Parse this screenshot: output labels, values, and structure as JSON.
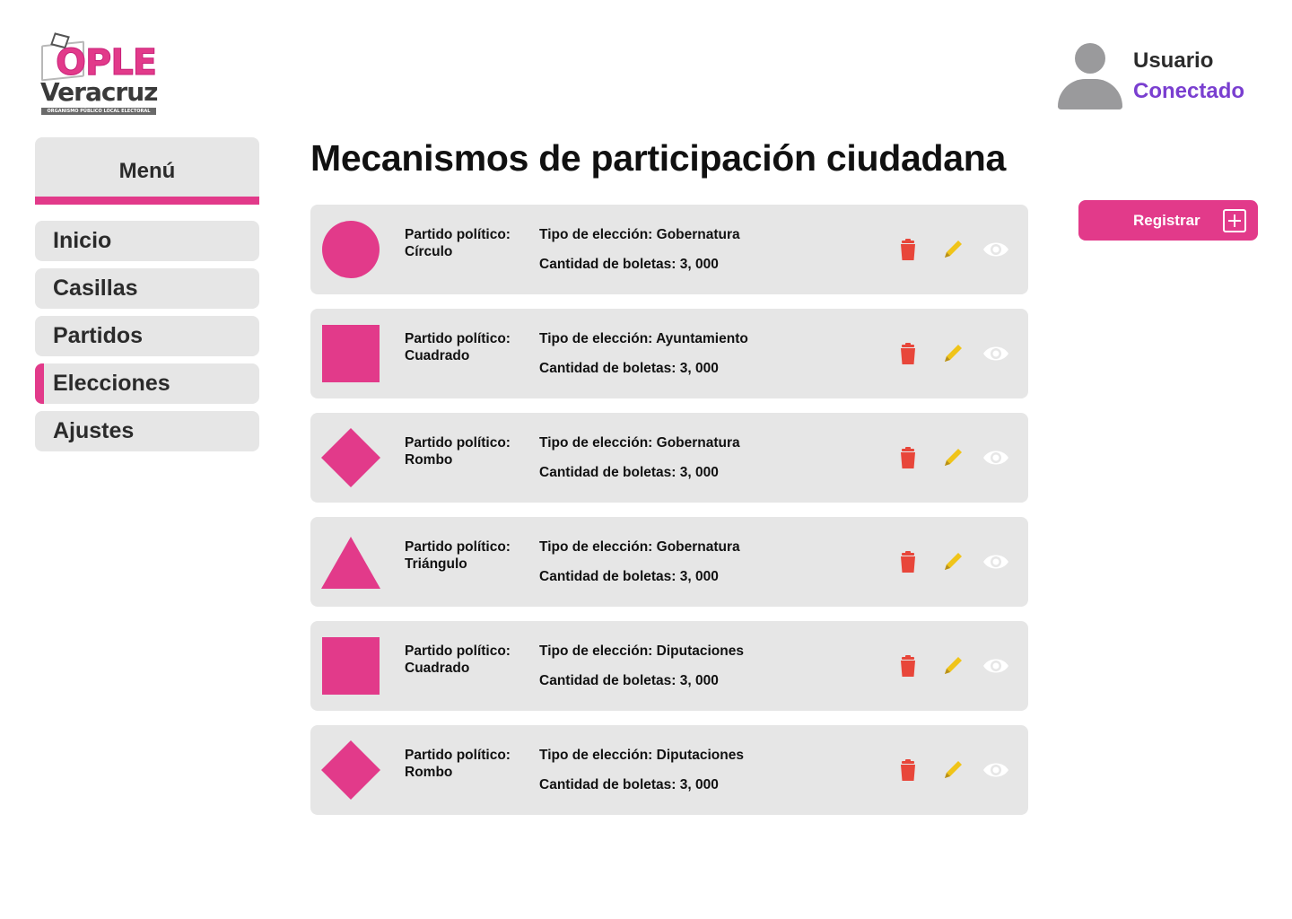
{
  "logo": {
    "main": "OPLE",
    "city": "Veracruz",
    "subtitle": "ORGANISMO PÚBLICO LOCAL ELECTORAL"
  },
  "user": {
    "name": "Usuario",
    "status": "Conectado",
    "avatar_icon": "user-avatar-icon"
  },
  "menu": {
    "title": "Menú",
    "items": [
      {
        "label": "Inicio",
        "active": false
      },
      {
        "label": "Casillas",
        "active": false
      },
      {
        "label": "Partidos",
        "active": false
      },
      {
        "label": "Elecciones",
        "active": true
      },
      {
        "label": "Ajustes",
        "active": false
      }
    ]
  },
  "page": {
    "title": "Mecanismos de participación ciudadana"
  },
  "register_button": {
    "label": "Registrar",
    "icon": "plus-icon"
  },
  "records": [
    {
      "party_prefix": "Partido político:",
      "party": "Círculo",
      "shape": "circle",
      "election_prefix": "Tipo de elección:",
      "election": "Gobernatura",
      "ballots_prefix": "Cantidad de boletas:",
      "ballots": "3, 000"
    },
    {
      "party_prefix": "Partido político:",
      "party": "Cuadrado",
      "shape": "square",
      "election_prefix": "Tipo de elección:",
      "election": "Ayuntamiento",
      "ballots_prefix": "Cantidad de boletas:",
      "ballots": "3, 000"
    },
    {
      "party_prefix": "Partido político:",
      "party": "Rombo",
      "shape": "diamond",
      "election_prefix": "Tipo de elección:",
      "election": "Gobernatura",
      "ballots_prefix": "Cantidad de boletas:",
      "ballots": "3, 000"
    },
    {
      "party_prefix": "Partido político:",
      "party": "Triángulo",
      "shape": "triangle",
      "election_prefix": "Tipo de elección:",
      "election": "Gobernatura",
      "ballots_prefix": "Cantidad de boletas:",
      "ballots": "3, 000"
    },
    {
      "party_prefix": "Partido político:",
      "party": "Cuadrado",
      "shape": "square",
      "election_prefix": "Tipo de elección:",
      "election": "Diputaciones",
      "ballots_prefix": "Cantidad de boletas:",
      "ballots": "3, 000"
    },
    {
      "party_prefix": "Partido político:",
      "party": "Rombo",
      "shape": "diamond",
      "election_prefix": "Tipo de elección:",
      "election": "Diputaciones",
      "ballots_prefix": "Cantidad de boletas:",
      "ballots": "3, 000"
    }
  ],
  "actions": {
    "delete_icon": "trash-icon",
    "edit_icon": "pencil-icon",
    "view_icon": "eye-icon"
  },
  "colors": {
    "brand_pink": "#e23a8a",
    "status_purple": "#7a3fd0",
    "card_gray": "#e6e6e6",
    "delete_red": "#e8463a",
    "edit_yellow": "#f0c419",
    "view_white": "#ffffff"
  }
}
